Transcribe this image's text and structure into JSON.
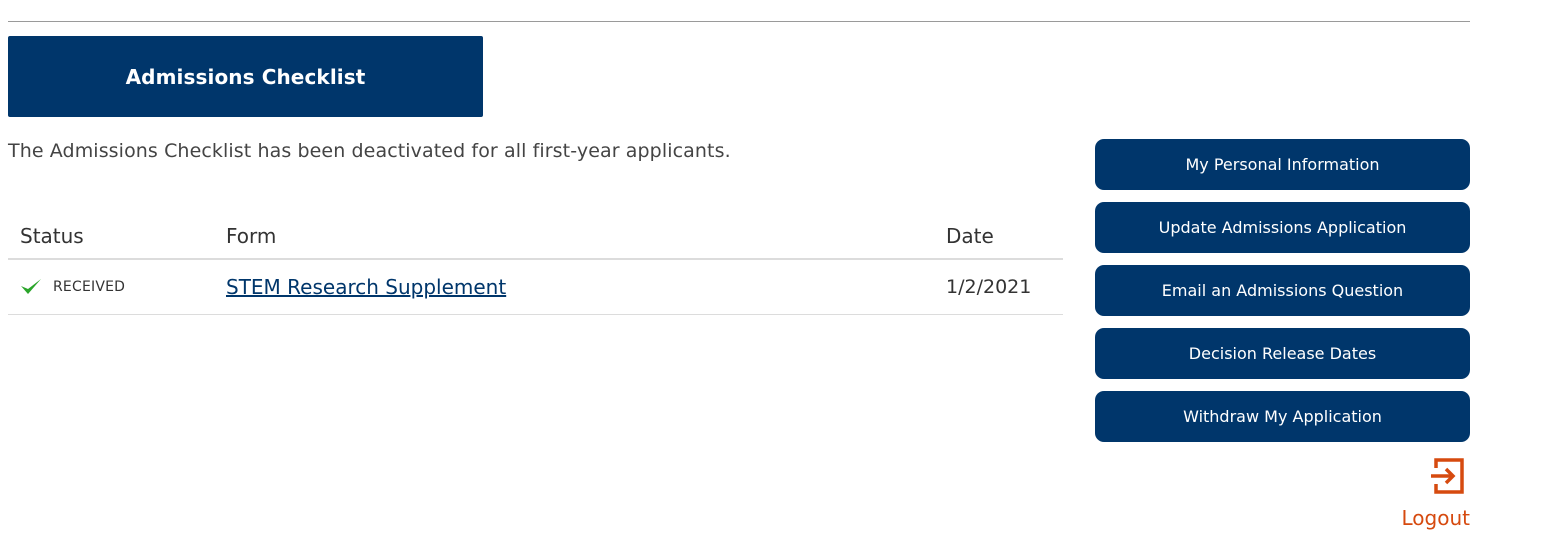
{
  "header": {
    "title": "Admissions Checklist"
  },
  "notice": {
    "text": "The Admissions Checklist has been deactivated for all first-year applicants."
  },
  "checklist": {
    "columns": {
      "status": "Status",
      "form": "Form",
      "date": "Date"
    },
    "rows": [
      {
        "status": "RECEIVED",
        "status_icon": "check-icon",
        "form": "STEM Research Supplement",
        "date": "1/2/2021"
      }
    ]
  },
  "sidebar": {
    "items": [
      {
        "label": "My Personal Information"
      },
      {
        "label": "Update Admissions Application"
      },
      {
        "label": "Email an Admissions Question"
      },
      {
        "label": "Decision Release Dates"
      },
      {
        "label": "Withdraw My Application"
      }
    ]
  },
  "logout": {
    "label": "Logout",
    "icon": "logout-icon"
  },
  "colors": {
    "primary": "#00366b",
    "accent": "#d64a0f",
    "success": "#2aa52a"
  }
}
